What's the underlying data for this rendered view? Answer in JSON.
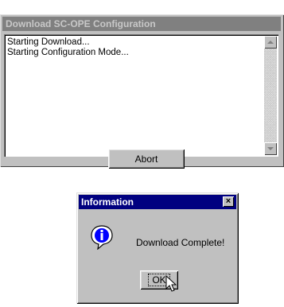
{
  "main_window": {
    "title": "Download SC-OPE Configuration",
    "log_lines": [
      "Starting Download...",
      "Starting Configuration Mode..."
    ],
    "abort_label": "Abort"
  },
  "info_dialog": {
    "title": "Information",
    "close_label": "×",
    "message": "Download Complete!",
    "ok_label": "OK",
    "icon": "info-icon"
  }
}
